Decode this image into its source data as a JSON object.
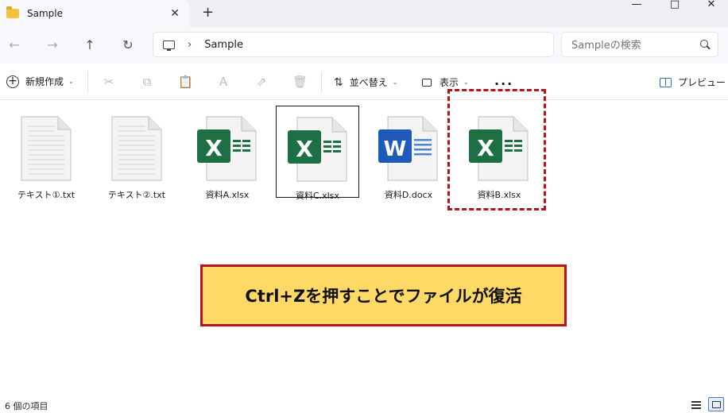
{
  "window": {
    "tab_title": "Sample",
    "tab_close": "✕",
    "tab_add": "+",
    "minimize": "—",
    "maximize": "□",
    "close": "✕"
  },
  "nav": {
    "back": "←",
    "forward": "→",
    "up": "↑",
    "refresh": "↻",
    "breadcrumb_sep": "›",
    "breadcrumb": "Sample",
    "search_placeholder": "Sampleの検索"
  },
  "toolbar": {
    "new_label": "新規作成",
    "new_chevron": "⌄",
    "cut": "✂",
    "copy": "⧉",
    "paste": "📋",
    "rename": "Ａ",
    "share": "⇗",
    "delete": "🗑",
    "sort_icon": "⇅",
    "sort_label": "並べ替え",
    "sort_chevron": "⌄",
    "view_label": "表示",
    "view_chevron": "⌄",
    "more": "...",
    "preview_label": "プレビュー"
  },
  "files": [
    {
      "name": "テキスト①.txt",
      "type": "txt"
    },
    {
      "name": "テキスト②.txt",
      "type": "txt"
    },
    {
      "name": "資料A.xlsx",
      "type": "xlsx"
    },
    {
      "name": "資料C.xlsx",
      "type": "xlsx",
      "selected": true
    },
    {
      "name": "資料D.docx",
      "type": "docx"
    },
    {
      "name": "資料B.xlsx",
      "type": "xlsx",
      "highlighted": true
    }
  ],
  "banner": {
    "text": "Ctrl+Zを押すことでファイルが復活"
  },
  "status": {
    "item_count": "6 個の項目"
  },
  "colors": {
    "excel_green": "#1d7044",
    "word_blue": "#1e5bb8",
    "highlight_red": "#b8121a",
    "banner_yellow": "#ffd966"
  }
}
